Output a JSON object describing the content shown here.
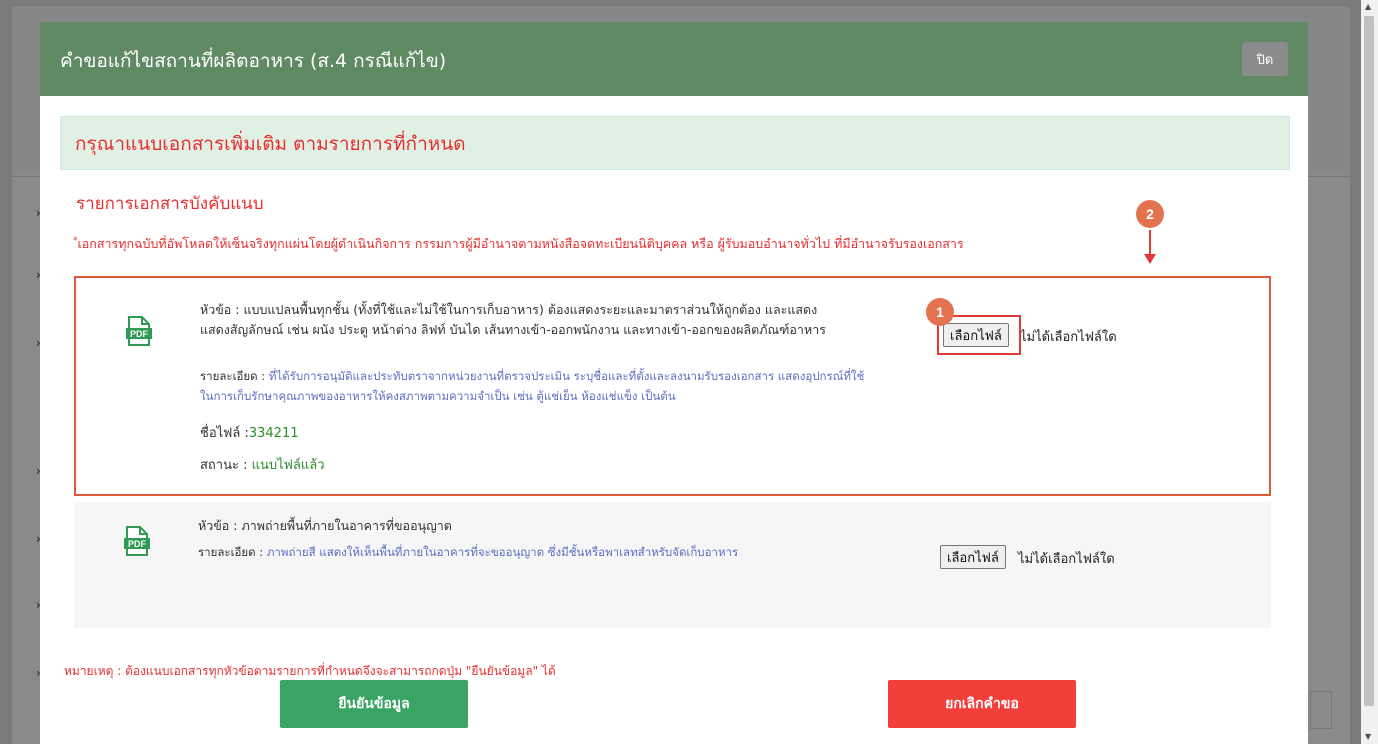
{
  "modal": {
    "title": "คำขอแก้ไขสถานที่ผลิตอาหาร (ส.4 กรณีแก้ไข)",
    "close_label": "ปิด"
  },
  "notice": {
    "title": "กรุณาแนบเอกสารเพิ่มเติม ตามรายการที่กำหนด",
    "required_title": "รายการเอกสารบังคับแนบ",
    "asterisk": "*",
    "required_note": "เอกสารทุกฉบับที่อัพโหลดให้เซ็นจริงทุกแผ่นโดยผู้ดำเนินกิจการ กรรมการผู้มีอำนาจตามหนังสือจดทะเบียนนิติบุคคล หรือ ผู้รับมอบอำนาจทั่วไป ที่มีอำนาจรับรองเอกสาร"
  },
  "documents": [
    {
      "icon": "pdf-icon",
      "heading_label": "หัวข้อ : ",
      "heading_line1": "แบบแปลนพื้นทุกชั้น (ทั้งที่ใช้และไม่ใช้ในการเก็บอาหาร) ต้องแสดงระยะและมาตราส่วนให้ถูกต้อง และแสดง",
      "heading_line2": "แสดงสัญลักษณ์ เช่น ผนัง ประตู หน้าต่าง ลิฟท์ บันได เส้นทางเข้า-ออกพนักงาน และทางเข้า-ออกของผลิตภัณฑ์อาหาร",
      "detail_label": "รายละเอียด : ",
      "detail_line1": "ที่ได้รับการอนุมัติและประทับตราจากหน่วยงานที่ตรวจประเมิน ระบุชื่อและที่ตั้งและลงนามรับรองเอกสาร แสดงอุปกรณ์ที่ใช้",
      "detail_line2": "ในการเก็บรักษาคุณภาพของอาหารให้คงสภาพตามความจำเป็น เช่น ตู้แช่เย็น ห้องแช่แข็ง เป็นต้น",
      "file_label": "ชื่อไฟล์ :",
      "file_name": "334211",
      "status_label": "สถานะ : ",
      "status_value": "แนบไฟล์แล้ว",
      "choose_file": "เลือกไฟล์",
      "no_file": "ไม่ได้เลือกไฟล์ใด"
    },
    {
      "icon": "pdf-icon",
      "heading_label": "หัวข้อ : ",
      "heading_line1": "ภาพถ่ายพื้นที่ภายในอาคารที่ขออนุญาต",
      "detail_label": "รายละเอียด : ",
      "detail_line1": "ภาพถ่ายสี แสดงให้เห็นพื้นที่ภายในอาคารที่จะขออนุญาต ซึ่งมีชั้นหรือพาเลทสำหรับจัดเก็บอาหาร",
      "choose_file": "เลือกไฟล์",
      "no_file": "ไม่ได้เลือกไฟล์ใด"
    }
  ],
  "annotations": {
    "step1": "1",
    "step2": "2"
  },
  "remark": "หมายเหตุ : ต้องแนบเอกสารทุกหัวข้อตามรายการที่กำหนดจึงจะสามารถกดปุ่ม \"ยืนยันข้อมูล\" ได้",
  "buttons": {
    "confirm": "ยืนยันข้อมูล",
    "cancel": "ยกเลิกคำขอ"
  },
  "colors": {
    "header": "#5f8a63",
    "alert": "#e62f2f",
    "confirm": "#3aa464",
    "cancel": "#f23f3a"
  }
}
